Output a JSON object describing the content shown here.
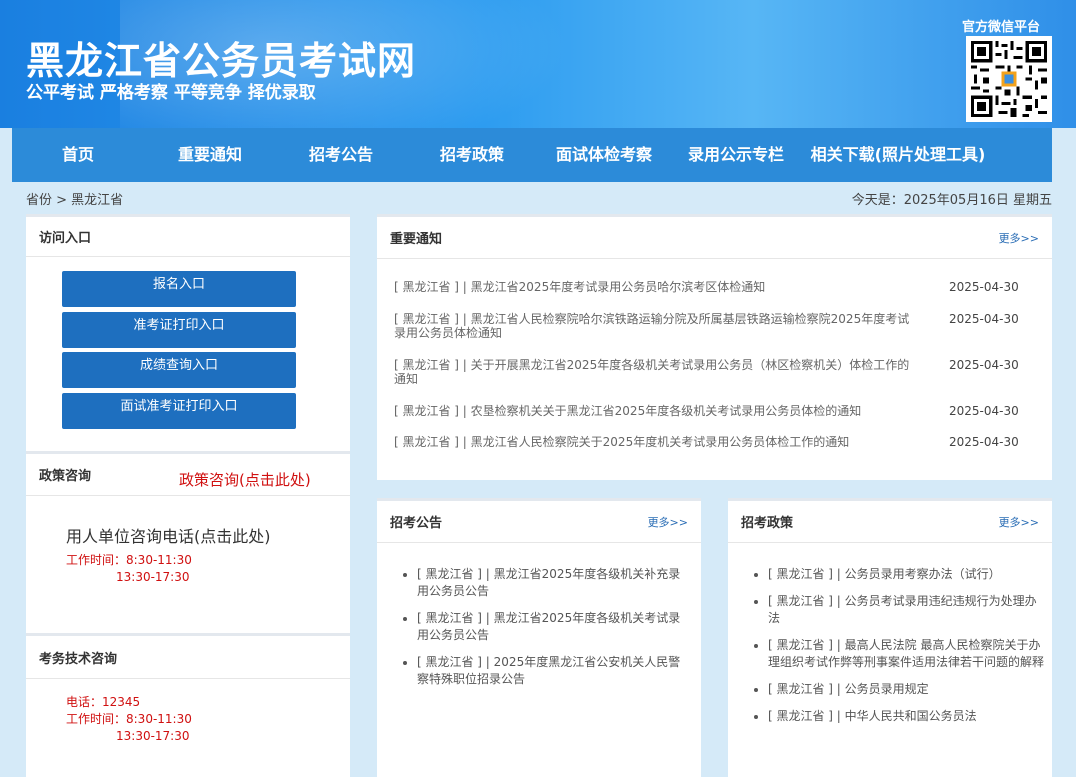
{
  "header": {
    "title": "黑龙江省公务员考试网",
    "slogan": "公平考试 严格考察 平等竞争 择优录取",
    "qr_title": "官方微信平台",
    "qr_icon": "qr-code-icon"
  },
  "nav": {
    "items": [
      {
        "label": "首页"
      },
      {
        "label": "重要通知"
      },
      {
        "label": "招考公告"
      },
      {
        "label": "招考政策"
      },
      {
        "label": "面试体检考察"
      },
      {
        "label": "录用公示专栏"
      },
      {
        "label": "相关下载(照片处理工具)"
      }
    ]
  },
  "breadcrumb": "省份 > 黑龙江省",
  "today": "今天是：2025年05月16日 星期五",
  "access": {
    "title": "访问入口",
    "buttons": [
      "报名入口",
      "准考证打印入口",
      "成绩查询入口",
      "面试准考证打印入口"
    ]
  },
  "policy_consult": {
    "title": "政策咨询",
    "link": "政策咨询(点击此处)",
    "employer_link": "用人单位咨询电话(点击此处)",
    "hours_line1": "工作时间：8:30-11:30",
    "hours_line2": "13:30-17:30"
  },
  "tech_consult": {
    "title": "考务技术咨询",
    "phone": "电话：12345",
    "hours_line1": "工作时间：8:30-11:30",
    "hours_line2": "13:30-17:30"
  },
  "notices": {
    "title": "重要通知",
    "more": "更多>>",
    "items": [
      {
        "text": "[ 黑龙江省 ] | 黑龙江省2025年度考试录用公务员哈尔滨考区体检通知",
        "date": "2025-04-30"
      },
      {
        "text": "[ 黑龙江省 ] | 黑龙江省人民检察院哈尔滨铁路运输分院及所属基层铁路运输检察院2025年度考试录用公务员体检通知",
        "date": "2025-04-30"
      },
      {
        "text": "[ 黑龙江省 ] | 关于开展黑龙江省2025年度各级机关考试录用公务员（林区检察机关）体检工作的通知",
        "date": "2025-04-30"
      },
      {
        "text": "[ 黑龙江省 ] | 农垦检察机关关于黑龙江省2025年度各级机关考试录用公务员体检的通知",
        "date": "2025-04-30"
      },
      {
        "text": "[ 黑龙江省 ] | 黑龙江省人民检察院关于2025年度机关考试录用公务员体检工作的通知",
        "date": "2025-04-30"
      }
    ]
  },
  "announcements": {
    "title": "招考公告",
    "more": "更多>>",
    "items": [
      "[ 黑龙江省 ] | 黑龙江省2025年度各级机关补充录用公务员公告",
      "[ 黑龙江省 ] | 黑龙江省2025年度各级机关考试录用公务员公告",
      "[ 黑龙江省 ] | 2025年度黑龙江省公安机关人民警察特殊职位招录公告"
    ]
  },
  "policies": {
    "title": "招考政策",
    "more": "更多>>",
    "items": [
      "[ 黑龙江省 ] | 公务员录用考察办法（试行）",
      "[ 黑龙江省 ] | 公务员考试录用违纪违规行为处理办法",
      "[ 黑龙江省 ] | 最高人民法院 最高人民检察院关于办理组织考试作弊等刑事案件适用法律若干问题的解释",
      "[ 黑龙江省 ] | 公务员录用规定",
      "[ 黑龙江省 ] | 中华人民共和国公务员法"
    ]
  },
  "colors": {
    "header_blue": "#1a7fe0",
    "nav_blue": "#2c8bd9",
    "button_blue": "#1e6fbf",
    "alert_red": "#d01010"
  }
}
